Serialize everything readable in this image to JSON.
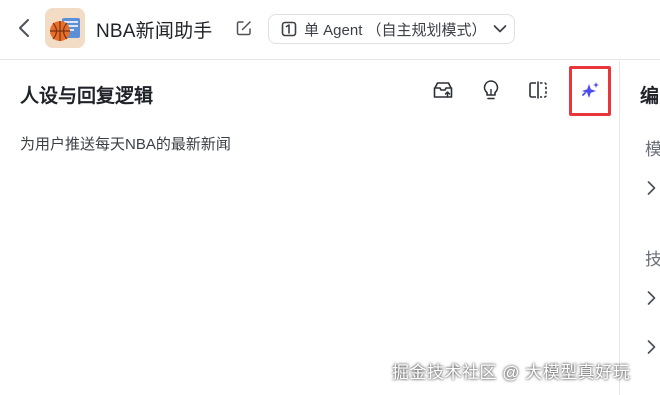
{
  "header": {
    "back_icon": "chevron-left-icon",
    "avatar_icon": "basketball-news-avatar",
    "agent_name": "NBA新闻助手",
    "edit_icon": "edit-icon",
    "mode_icon": "agent-mode-icon",
    "mode_label": "单 Agent （自主规划模式）",
    "mode_chevron": "chevron-down-icon"
  },
  "persona": {
    "title": "人设与回复逻辑",
    "toolbar": [
      "template-icon",
      "lightbulb-icon",
      "split-view-icon",
      "ai-sparkle-icon"
    ],
    "prompt_text": "为用户推送每天NBA的最新新闻"
  },
  "right_panel": {
    "title_partial": "编",
    "group1_partial": "模",
    "group2_partial": "技"
  },
  "watermark": "掘金技术社区 @ 大模型真好玩",
  "colors": {
    "accent_sparkle": "#4a4cf0",
    "highlight_border": "#e8363c",
    "divider": "#e4e6ea"
  }
}
